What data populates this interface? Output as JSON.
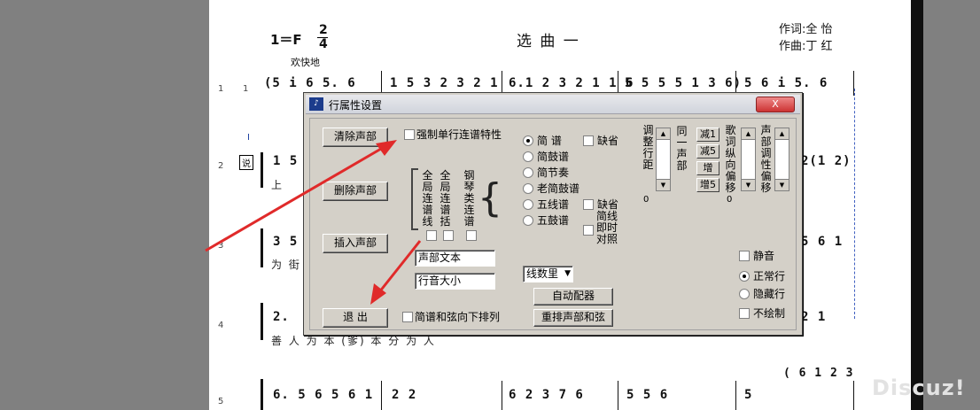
{
  "score": {
    "key": "1＝F",
    "time_top": "2",
    "time_bottom": "4",
    "title": "选 曲 一",
    "lyricist": "作词:全  怡",
    "composer": "作曲:丁  红",
    "tempo": "欢快地",
    "systems": [
      {
        "row": "1",
        "staff": "1",
        "measures": [
          "(5  i 6  5. 6",
          "1 5 3  2 3 2 1",
          "6.1 2 3  2 1 1 6",
          "5  5 5  5 1 3 6)",
          "5  6 i  5. 6"
        ]
      },
      {
        "row": "2",
        "staff": "1",
        "marker": "I",
        "box": "说",
        "lead": "1  5",
        "tail": "2(1 2)",
        "lyric": "上"
      },
      {
        "row": "3",
        "staff": "1",
        "lead": "3  5",
        "tail": "5 6 1",
        "lyric": "为 街"
      },
      {
        "row": "4",
        "staff": "1",
        "lead": "2.",
        "tail": "2  1",
        "lyric": "善    人 为        本        (爹) 本 分        为 人"
      },
      {
        "row": "5",
        "staff": "1",
        "measures": [
          "6. 5  6 5 6 1",
          "2   2",
          "6 2 3  7 6",
          "5   5   6",
          "5"
        ],
        "tail": "( 6 1 2 3"
      }
    ]
  },
  "dialog": {
    "title": "行属性设置",
    "close_label": "X",
    "buttons": {
      "clear_voice": "清除声部",
      "delete_voice": "删除声部",
      "insert_voice": "插入声部",
      "exit": "退 出",
      "auto_chord": "自动配器",
      "rearrange": "重排声部和弦"
    },
    "checkboxes": {
      "force_single_line": "强制单行连谱特性",
      "simple_below": "简谱和弦向下排列",
      "omit1": "缺省",
      "omit2": "缺省",
      "simple_instant": "简线即时对照",
      "mute": "静音",
      "no_draw": "不绘制"
    },
    "vertical_labels": {
      "global_connect": "全局连谱线",
      "global_connect2": "全局连谱括",
      "piano_connect": "钢琴类连谱",
      "adjust_spacing": "调整行距",
      "same_voice": "同一声部",
      "lyric_shift": "歌词纵向偏移",
      "voice_shift": "声部调性偏移"
    },
    "notation_types": [
      "简  谱",
      "简鼓谱",
      "简节奏",
      "老简鼓谱",
      "五线谱",
      "五鼓谱"
    ],
    "selected_notation": "简  谱",
    "line_modes": [
      "正常行",
      "隐藏行"
    ],
    "selected_line_mode": "正常行",
    "fields": {
      "voice_text": "声部文本",
      "line_size": "行音大小"
    },
    "line_count_select": "线数里",
    "transpose_buttons": [
      "减1",
      "减5",
      "增",
      "增5"
    ],
    "spin_values": {
      "spacing": "0",
      "lyric": "0"
    }
  },
  "watermark": "Discuz!",
  "colors": {
    "arrow": "#e02a2a",
    "page": "#ffffff",
    "bg": "#808080"
  }
}
